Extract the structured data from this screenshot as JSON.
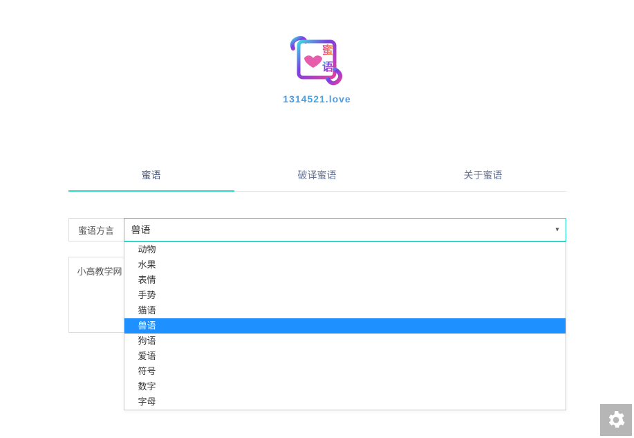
{
  "logo": {
    "char1": "蜜",
    "char2": "语",
    "tagline": "1314521.love"
  },
  "tabs": [
    {
      "label": "蜜语",
      "active": true
    },
    {
      "label": "破译蜜语",
      "active": false
    },
    {
      "label": "关于蜜语",
      "active": false
    }
  ],
  "form": {
    "dialect_label": "蜜语方言",
    "selected": "兽语",
    "options": [
      "动物",
      "水果",
      "表情",
      "手势",
      "猫语",
      "兽语",
      "狗语",
      "爱语",
      "符号",
      "数字",
      "字母"
    ]
  },
  "textarea": {
    "value": "小高教学网"
  },
  "colors": {
    "accent": "#2ddbc5",
    "tab_text": "#657398",
    "highlight": "#1e90ff"
  }
}
